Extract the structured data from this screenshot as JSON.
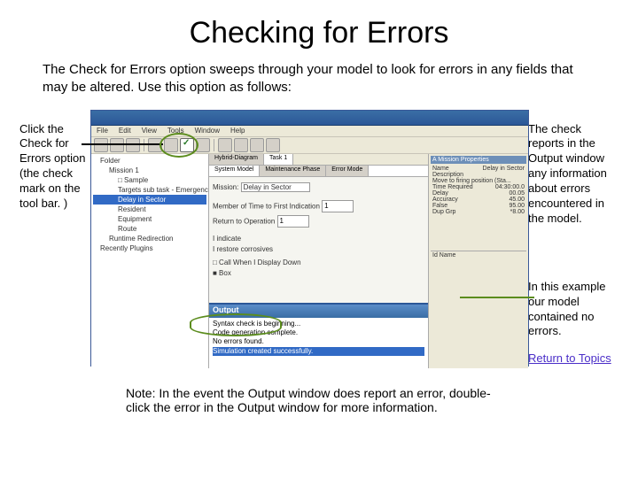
{
  "title": "Checking for Errors",
  "intro": "The Check for Errors option sweeps through your model to look for errors in any fields that may be altered.  Use this option as follows:",
  "left_note": "Click the Check for Errors option (the check mark on the tool bar. )",
  "right_note_1": "The check reports in the Output window any information about errors encountered in the model.",
  "right_note_2": "In this example our model contained no errors.",
  "return_link": "Return to Topics",
  "bottom_note": "Note: In the event the Output window does report an error, double-click the error in the Output window for more information.",
  "app": {
    "menubar": [
      "File",
      "Edit",
      "View",
      "Tools",
      "Window",
      "Help"
    ],
    "tabs": [
      "Hybrid-Diagram",
      "Task 1"
    ],
    "inner_tabs": [
      "System Model",
      "Maintenance Phase",
      "Error Mode"
    ],
    "combo_label": "Mission:",
    "combo_value": "Delay in Sector",
    "form_rows": [
      {
        "label": "Member of",
        "field": "Time to First Indication",
        "val": "1"
      },
      {
        "label": "",
        "field": "Return to Operation",
        "val": "1"
      }
    ],
    "extra_labels": [
      "I indicate",
      "I restore corrosives",
      "□ Call When I Display Down",
      "■ Box"
    ],
    "tree": [
      "Folder",
      "Mission 1",
      "□ Sample",
      "Targets sub task - Emergency Safety Rev.",
      "Delay in Sector",
      "Resident",
      "Equipment",
      "Route",
      "Runtime Redirection",
      "Recently Plugins"
    ],
    "output": {
      "title": "Output",
      "lines": [
        "Syntax check is beginning...",
        "Code generation complete.",
        "No errors found.",
        "Simulation created successfully."
      ]
    },
    "props": {
      "header": "A Mission Properties",
      "rows": [
        {
          "k": "Name",
          "v": "Delay in Sector"
        },
        {
          "k": "Description",
          "v": "Move to firing position (Sta..."
        },
        {
          "k": "Time Required",
          "v": "04:30:00.0"
        },
        {
          "k": "Delay",
          "v": "00.05"
        },
        {
          "k": "Accuracy",
          "v": "45.00"
        },
        {
          "k": "False",
          "v": "95.00"
        },
        {
          "k": "Dup Grp",
          "v": "*8.00"
        }
      ],
      "id_header": "Id Name"
    }
  }
}
